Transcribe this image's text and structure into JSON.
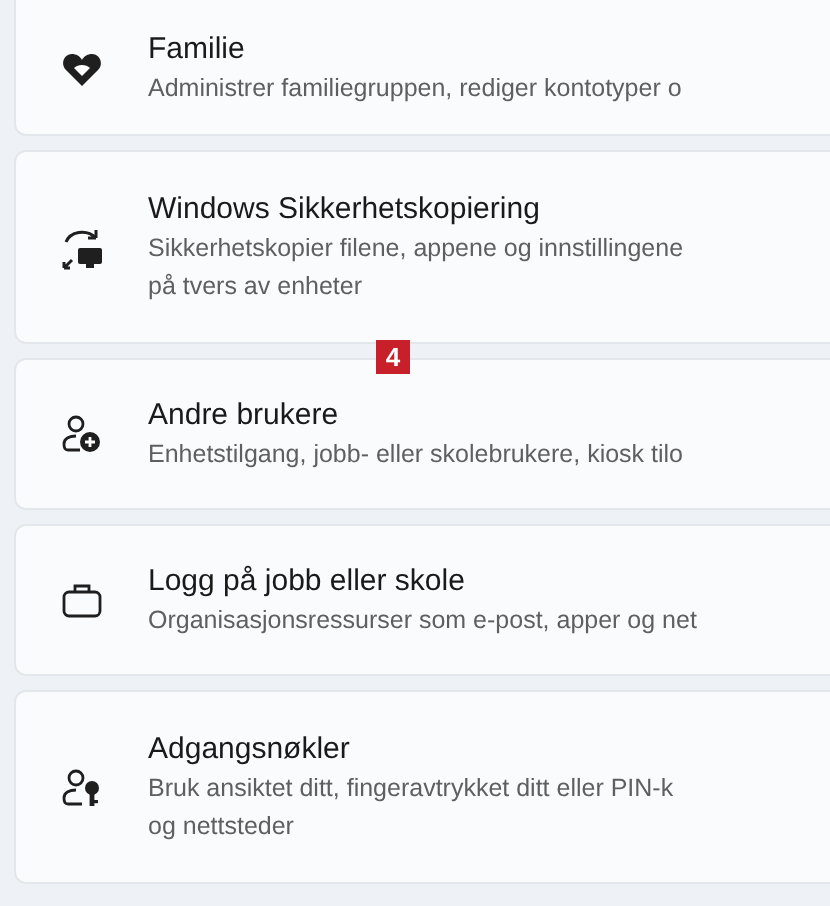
{
  "items": [
    {
      "kind": "family",
      "title": "Familie",
      "description": [
        "Administrer familiegruppen, rediger kontotyper o"
      ]
    },
    {
      "kind": "backup",
      "title": "Windows Sikkerhetskopiering",
      "description": [
        "Sikkerhetskopier filene, appene og innstillingene",
        "på tvers av enheter"
      ]
    },
    {
      "kind": "users",
      "title": "Andre brukere",
      "description": [
        "Enhetstilgang, jobb- eller skolebrukere, kiosk tilo"
      ]
    },
    {
      "kind": "work",
      "title": "Logg på jobb eller skole",
      "description": [
        "Organisasjonsressurser som e-post, apper og net"
      ]
    },
    {
      "kind": "passkey",
      "title": "Adgangsnøkler",
      "description": [
        "Bruk ansiktet ditt, fingeravtrykket ditt eller PIN-k",
        "og nettsteder"
      ]
    }
  ],
  "badge": "4"
}
